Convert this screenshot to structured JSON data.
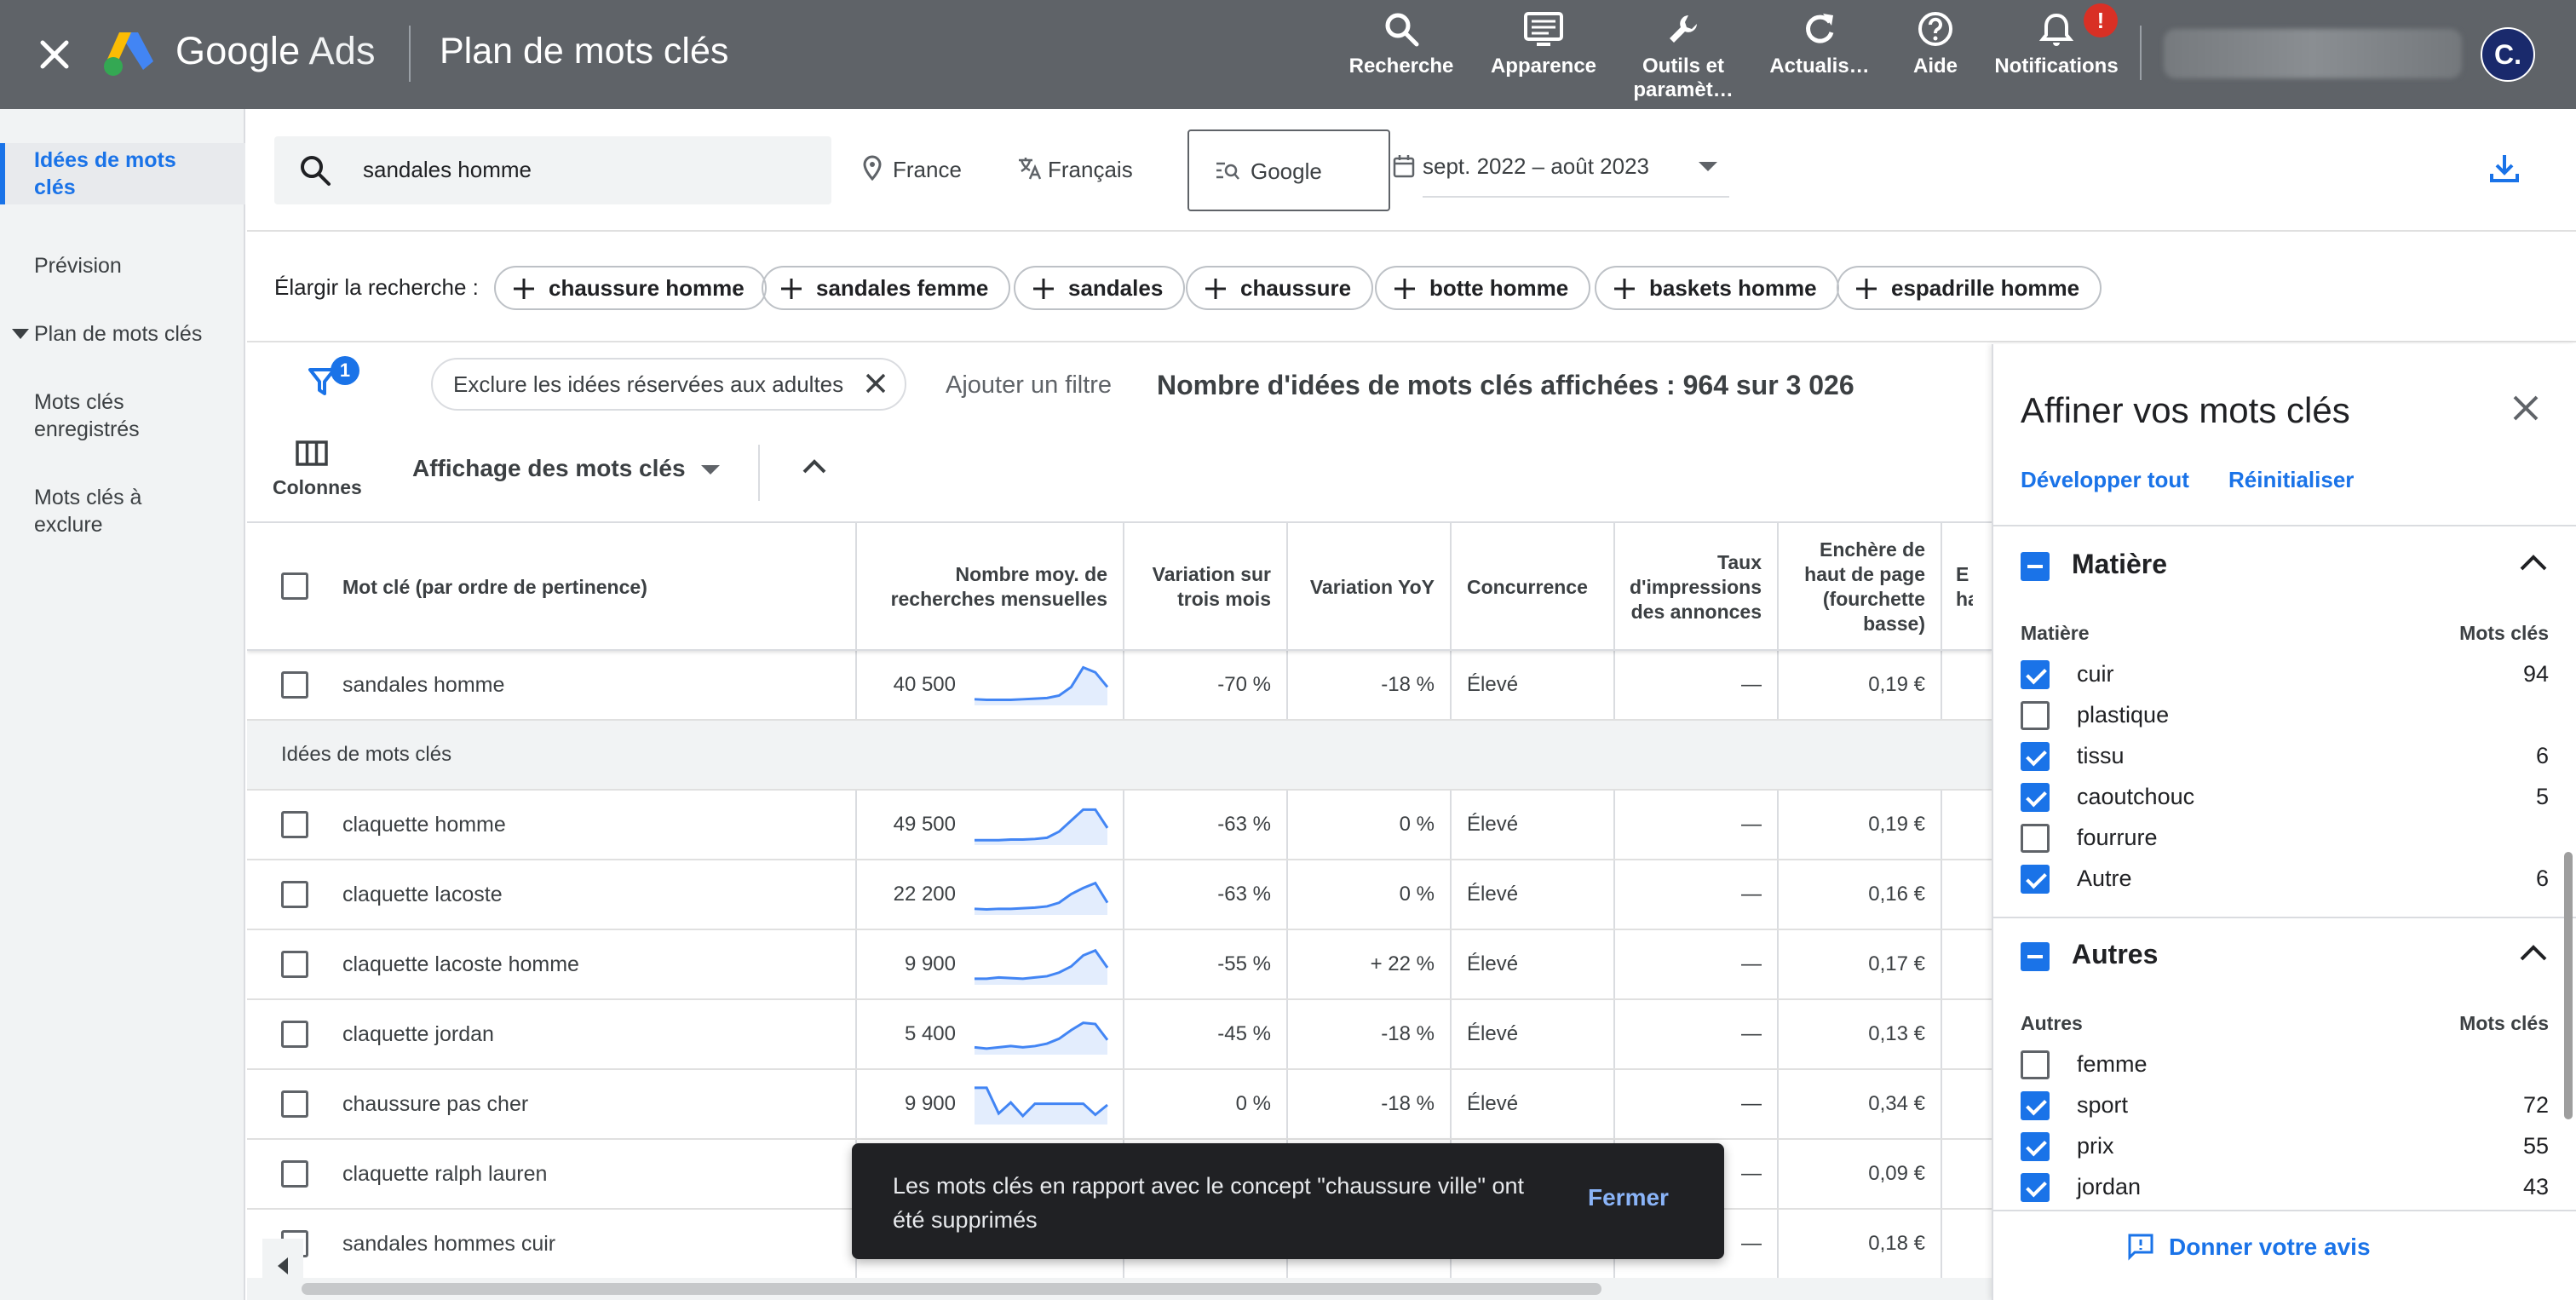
{
  "app": {
    "brand_google": "Google",
    "brand_ads": "Ads",
    "page_title": "Plan de mots clés",
    "tools": [
      {
        "label": "Recherche",
        "icon": "search-icon"
      },
      {
        "label": "Apparence",
        "icon": "appearance-icon"
      },
      {
        "label": "Outils et",
        "label2": "paramèt…",
        "icon": "wrench-icon"
      },
      {
        "label": "Actualis…",
        "icon": "refresh-icon"
      },
      {
        "label": "Aide",
        "icon": "help-icon"
      },
      {
        "label": "Notifications",
        "icon": "bell-icon",
        "badge": "!"
      }
    ],
    "avatar_initial": "C."
  },
  "sidebar": {
    "items": [
      {
        "label": "Idées de mots clés",
        "active": true
      },
      {
        "label": "Prévision"
      },
      {
        "label": "Plan de mots clés",
        "expander": true
      },
      {
        "label": "Mots clés enregistrés"
      },
      {
        "label": "Mots clés à exclure"
      }
    ]
  },
  "search": {
    "query": "sandales homme",
    "location": "France",
    "language": "Français",
    "network": "Google",
    "date_range": "sept. 2022 – août 2023"
  },
  "broaden": {
    "label": "Élargir la recherche :",
    "chips": [
      "chaussure homme",
      "sandales femme",
      "sandales",
      "chaussure",
      "botte homme",
      "baskets homme",
      "espadrille homme"
    ]
  },
  "filters": {
    "badge": "1",
    "exclude_chip": "Exclure les idées réservées aux adultes",
    "add_filter": "Ajouter un filtre",
    "count_label": "Nombre d'idées de mots clés affichées : 964 sur 3 026",
    "columns_label": "Colonnes",
    "view_label": "Affichage des mots clés"
  },
  "table": {
    "headers": {
      "keyword": "Mot clé (par ordre de pertinence)",
      "avg": "Nombre moy. de recherches mensuelles",
      "three_month": "Variation sur trois mois",
      "yoy": "Variation YoY",
      "competition": "Concurrence",
      "impr": "Taux d'impressions des annonces",
      "bid_low": "Enchère de haut de page (fourchette basse)",
      "bid_high": "E ha"
    },
    "group_label": "Idées de mots clés",
    "rows": [
      {
        "keyword": "sandales homme",
        "avg": "40 500",
        "three": "-70 %",
        "yoy": "-18 %",
        "comp": "Élevé",
        "impr": "—",
        "bid": "0,19 €",
        "trend": [
          10,
          9,
          9,
          9,
          10,
          11,
          12,
          16,
          30,
          62,
          54,
          30
        ]
      },
      {
        "keyword": "claquette homme",
        "avg": "49 500",
        "three": "-63 %",
        "yoy": "0 %",
        "comp": "Élevé",
        "impr": "—",
        "bid": "0,19 €",
        "trend": [
          8,
          8,
          8,
          9,
          9,
          10,
          12,
          22,
          40,
          58,
          58,
          28
        ]
      },
      {
        "keyword": "claquette lacoste",
        "avg": "22 200",
        "three": "-63 %",
        "yoy": "0 %",
        "comp": "Élevé",
        "impr": "—",
        "bid": "0,16 €",
        "trend": [
          10,
          9,
          10,
          10,
          11,
          12,
          14,
          20,
          34,
          44,
          52,
          20
        ]
      },
      {
        "keyword": "claquette lacoste homme",
        "avg": "9 900",
        "three": "-55 %",
        "yoy": "+ 22 %",
        "comp": "Élevé",
        "impr": "—",
        "bid": "0,17 €",
        "trend": [
          10,
          10,
          12,
          11,
          10,
          12,
          14,
          20,
          30,
          48,
          56,
          28
        ]
      },
      {
        "keyword": "claquette jordan",
        "avg": "5 400",
        "three": "-45 %",
        "yoy": "-18 %",
        "comp": "Élevé",
        "impr": "—",
        "bid": "0,13 €",
        "trend": [
          12,
          10,
          12,
          14,
          12,
          14,
          18,
          26,
          40,
          52,
          50,
          24
        ]
      },
      {
        "keyword": "chaussure pas cher",
        "avg": "9 900",
        "three": "0 %",
        "yoy": "-18 %",
        "comp": "Élevé",
        "impr": "—",
        "bid": "0,34 €",
        "trend": [
          60,
          60,
          18,
          36,
          14,
          34,
          34,
          34,
          34,
          34,
          16,
          32
        ]
      },
      {
        "keyword": "claquette ralph lauren",
        "avg": "",
        "three": "",
        "yoy": "",
        "comp": "",
        "impr": "—",
        "bid": "0,09 €",
        "trend": []
      },
      {
        "keyword": "sandales hommes cuir",
        "avg": "",
        "three": "",
        "yoy": "",
        "comp": "",
        "impr": "—",
        "bid": "0,18 €",
        "trend": []
      }
    ]
  },
  "snackbar": {
    "message": "Les mots clés en rapport avec le concept \"chaussure ville\" ont été supprimés",
    "action": "Fermer"
  },
  "refine": {
    "title": "Affiner vos mots clés",
    "expand_all": "Développer tout",
    "reset": "Réinitialiser",
    "sections": [
      {
        "title": "Matière",
        "sub_left": "Matière",
        "sub_right": "Mots clés",
        "options": [
          {
            "label": "cuir",
            "count": "94",
            "checked": true
          },
          {
            "label": "plastique",
            "count": "",
            "checked": false
          },
          {
            "label": "tissu",
            "count": "6",
            "checked": true
          },
          {
            "label": "caoutchouc",
            "count": "5",
            "checked": true
          },
          {
            "label": "fourrure",
            "count": "",
            "checked": false
          },
          {
            "label": "Autre",
            "count": "6",
            "checked": true
          }
        ]
      },
      {
        "title": "Autres",
        "sub_left": "Autres",
        "sub_right": "Mots clés",
        "options": [
          {
            "label": "femme",
            "count": "",
            "checked": false
          },
          {
            "label": "sport",
            "count": "72",
            "checked": true
          },
          {
            "label": "prix",
            "count": "55",
            "checked": true
          },
          {
            "label": "jordan",
            "count": "43",
            "checked": true
          }
        ]
      }
    ],
    "feedback": "Donner votre avis"
  },
  "colors": {
    "topbar": "#5f6368",
    "accent": "#1a73e8",
    "spark_line": "#4285f4",
    "spark_fill": "#e3edfd"
  }
}
